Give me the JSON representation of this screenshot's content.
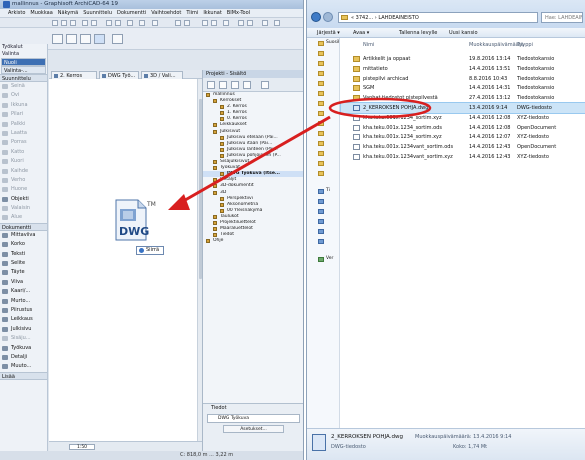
{
  "archicad": {
    "title": "mallinnus - Graphisoft ArchiCAD-64 19",
    "menus": [
      "Arkisto",
      "Muokkaa",
      "Näkymä",
      "Suunnittelu",
      "Dokumentti",
      "Vaihtoehdot",
      "Tiimi",
      "Ikkunat",
      "BIMx-Tool"
    ],
    "toolbox": {
      "title": "Työkalut",
      "select_label": "Valinta",
      "arrow_label": "Nuoli",
      "marquee_label": "Valinta-...",
      "design_category": "Suunnittelu",
      "design_tools": [
        "Seinä",
        "Ovi",
        "Ikkuna",
        "Pilari",
        "Palkki",
        "Laatta",
        "Porras",
        "Katto",
        "Kuori",
        "Kaihde",
        "Verho",
        "Huone",
        "Objekti",
        "Valaisin",
        "Alue"
      ],
      "document_category": "Dokumentti",
      "document_tools": [
        "Mittaviiva",
        "Korko",
        "Teksti",
        "Selite",
        "Täyte",
        "Viiva",
        "Kaari/...",
        "Murto...",
        "Piirustus",
        "Leikkaus",
        "Julkisivu",
        "Sisäju...",
        "Työkuva",
        "Detalji",
        "Muuto..."
      ],
      "more_label": "Lisää"
    },
    "tabs": [
      {
        "label": "2. Kerros"
      },
      {
        "label": "DWG Työ..."
      },
      {
        "label": "3D / Vali..."
      }
    ],
    "canvas_icon": {
      "label": "DWG",
      "trademark": "TM",
      "drop_label": "Siirrä"
    },
    "zoom_value": "1:50",
    "coords": "C: 818,0 m    ...   3,22 m",
    "navigator": {
      "title": "Projekti - Sisältö",
      "tree": [
        {
          "label": "mallinnus",
          "depth": 0
        },
        {
          "label": "Kerrokset",
          "depth": 1
        },
        {
          "label": "2. Kerros",
          "depth": 2
        },
        {
          "label": "1. Kerros",
          "depth": 2
        },
        {
          "label": "0. Kerros",
          "depth": 2
        },
        {
          "label": "Leikkaukset",
          "depth": 1
        },
        {
          "label": "Julkisivut",
          "depth": 1
        },
        {
          "label": "Julkisivu etelään (Pai...",
          "depth": 2
        },
        {
          "label": "Julkisivu itään (Pai...",
          "depth": 2
        },
        {
          "label": "Julkisivu länteen (Pai...",
          "depth": 2
        },
        {
          "label": "Julkisivu pohjoiseen (P...",
          "depth": 2
        },
        {
          "label": "Sisäjulkisivut",
          "depth": 1
        },
        {
          "label": "Työkuvat",
          "depth": 1
        },
        {
          "label": "DWG Työkuva (Itse...",
          "depth": 2
        },
        {
          "label": "Detaljit",
          "depth": 1
        },
        {
          "label": "3D-dokumentit",
          "depth": 1
        },
        {
          "label": "3D",
          "depth": 1
        },
        {
          "label": "Perspektiivi",
          "depth": 2
        },
        {
          "label": "Aksonometria",
          "depth": 2
        },
        {
          "label": "00 Yleisnäkymä",
          "depth": 2
        },
        {
          "label": "Taulukot",
          "depth": 1
        },
        {
          "label": "Projektiluettelot",
          "depth": 1
        },
        {
          "label": "Määräluettelot",
          "depth": 1
        },
        {
          "label": "Tiedot",
          "depth": 1
        },
        {
          "label": "Ohje",
          "depth": 0
        }
      ],
      "props_title": "Tiedot",
      "props_field": "DWG  Työkuva",
      "props_button": "Asetukset..."
    }
  },
  "explorer": {
    "path": "« 3742... › LAHDEAINEISTO",
    "search_placeholder": "Hae: LAHDEAINEISTO",
    "commands": {
      "organize": "Järjestä ▾",
      "open": "Avaa ▾",
      "print": "Tallenna levylle",
      "new_folder": "Uusi kansio"
    },
    "columns": {
      "name": "Nimi",
      "date": "Muokkauspäivämäärä",
      "type": "Tyyppi"
    },
    "left_pane": [
      {
        "label": "Suosikit",
        "kind": "folder"
      },
      {
        "label": "",
        "kind": "folder"
      },
      {
        "label": "",
        "kind": "folder"
      },
      {
        "label": "",
        "kind": "folder"
      },
      {
        "label": "",
        "kind": "folder"
      },
      {
        "label": "",
        "kind": "folder"
      },
      {
        "label": "",
        "kind": "folder"
      },
      {
        "label": "",
        "kind": "folder"
      },
      {
        "label": "",
        "kind": "folder"
      },
      {
        "label": "",
        "kind": "folder"
      },
      {
        "label": "",
        "kind": "folder"
      },
      {
        "label": "",
        "kind": "folder"
      },
      {
        "label": "",
        "kind": "folder"
      },
      {
        "label": "",
        "kind": "folder"
      },
      {
        "label": "Ti",
        "kind": "blue"
      },
      {
        "label": "",
        "kind": "blue"
      },
      {
        "label": "",
        "kind": "blue"
      },
      {
        "label": "",
        "kind": "blue"
      },
      {
        "label": "",
        "kind": "blue"
      },
      {
        "label": "",
        "kind": "blue"
      },
      {
        "label": "Ver",
        "kind": "green"
      }
    ],
    "files": [
      {
        "name": "Artikkelit ja oppaat",
        "date": "19.8.2016 13:14",
        "type": "Tiedostokansio",
        "kind": "folder"
      },
      {
        "name": "mittatieto",
        "date": "14.4.2016 13:51",
        "type": "Tiedostokansio",
        "kind": "folder"
      },
      {
        "name": "pistepilvi archicad",
        "date": "8.8.2016 10:43",
        "type": "Tiedostokansio",
        "kind": "folder"
      },
      {
        "name": "SGM",
        "date": "14.4.2016 14:31",
        "type": "Tiedostokansio",
        "kind": "folder"
      },
      {
        "name": "Vanhat tiedostot pistepilvestä",
        "date": "27.4.2016 13:12",
        "type": "Tiedostokansio",
        "kind": "folder"
      },
      {
        "name": "2_KERROKSEN POHJA.dwg",
        "date": "13.4.2016 9:14",
        "type": "DWG-tiedosto",
        "kind": "dwg",
        "selected": true
      },
      {
        "name": "kha.teku.001x.1234_sortim.xyz",
        "date": "14.4.2016 12:08",
        "type": "XYZ-tiedosto",
        "kind": "file"
      },
      {
        "name": "kha.teku.001x.1234_sortim.ods",
        "date": "14.4.2016 12:08",
        "type": "OpenDocument",
        "kind": "file"
      },
      {
        "name": "kha.teku.001x.1234_sortim.xyz",
        "date": "14.4.2016 12:07",
        "type": "XYZ-tiedosto",
        "kind": "file"
      },
      {
        "name": "kha.teku.001x.1234vant_sortim.ods",
        "date": "14.4.2016 12:43",
        "type": "OpenDocument",
        "kind": "file"
      },
      {
        "name": "kha.teku.001x.1234vant_sortim.xyz",
        "date": "14.4.2016 12:43",
        "type": "XYZ-tiedosto",
        "kind": "file"
      }
    ],
    "details": {
      "name": "2_KERROKSEN POHJA.dwg",
      "date_label": "Muokkauspäivämäärä: 13.4.2016 9:14",
      "type": "DWG-tiedosto",
      "size": "Koko: 1,74 Mt"
    }
  },
  "colors": {
    "annotation": "#d81f1f",
    "selection": "#cce4f7",
    "accent": "#3d6fb3"
  }
}
